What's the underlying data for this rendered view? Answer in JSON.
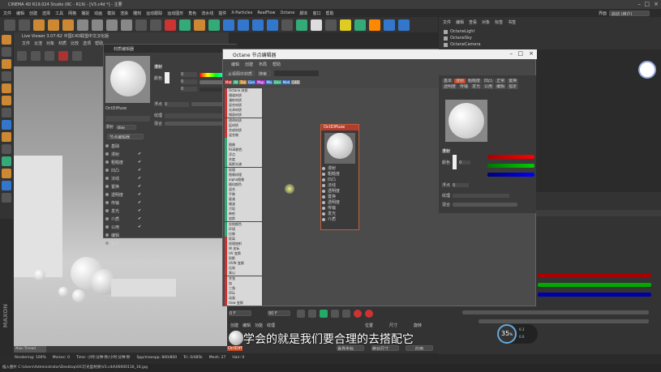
{
  "titlebar": {
    "title": "CINEMA 4D R19.024 Studio (RC - R19) - [V3.c4d *] - 主要"
  },
  "menubar": {
    "items": [
      "文件",
      "编辑",
      "创建",
      "选择",
      "工具",
      "网格",
      "捕捉",
      "动画",
      "模拟",
      "渲染",
      "雕刻",
      "运动跟踪",
      "运动图形",
      "角色",
      "流水线",
      "插件",
      "X-Particles",
      "RealFlow",
      "Octane",
      "脚本",
      "窗口",
      "帮助"
    ],
    "layout_label": "界面",
    "layout_value": "启动 (用户)"
  },
  "live_viewer": {
    "title": "Live Viewer 3.07-R2 中国C4D联盟中文汉化版",
    "menus": [
      "文件",
      "云渲",
      "对象",
      "材质",
      "比较",
      "选项",
      "帮助"
    ]
  },
  "mat_editor": {
    "title": "材质编辑器",
    "mat_name": "OctDiffuse",
    "sections": [
      "基础",
      "漫射",
      "粗糙度",
      "凹凸",
      "法线",
      "置换",
      "透明度",
      "传输",
      "发光",
      "介质",
      "公用",
      "编辑",
      "指定"
    ],
    "diffuse_label": "漫射",
    "color_label": "颜色",
    "float_label": "浮点",
    "texture_label": "纹理",
    "mix_label": "混合",
    "h": "0",
    "s": "0",
    "v": "0",
    "float_val": "0",
    "node_btn": "节点编辑器",
    "mode_label": "漫射"
  },
  "node_editor": {
    "title": "Octane 节点编辑器",
    "menus": [
      "编辑",
      "创建",
      "布局",
      "帮助"
    ],
    "btn_load": "从视图中材质",
    "btn_search": "搜索",
    "tabs": [
      "Mat",
      "All",
      "Tex",
      "Gen",
      "Map",
      "Mis",
      "Emi",
      "Med",
      "C4D"
    ],
    "list": [
      "Octane 材质",
      "通道材质",
      "漫射材质",
      "混合材质",
      "光泽材质",
      "镜面材质",
      "透明材质",
      "层材质",
      "合成材质",
      "混合物",
      ".",
      "图像",
      "RGB颜色",
      "浮点",
      "灰度",
      "高斯光谱",
      "纹理",
      "图像纹理",
      "alpha图像",
      "随机颜色",
      "混合",
      "平移",
      "衰减",
      "噪波",
      "污垢",
      "映射",
      "追踪",
      "实例颜色",
      "环境",
      "位移",
      "距离",
      "纹理放射",
      "W 坐标",
      "UV 变换",
      "投影",
      "UVW 变换",
      "比较",
      "乘以",
      "余弦",
      "加",
      "三角",
      "OSL",
      "动画",
      "Uvw 变换"
    ],
    "node_title": "OctDiffuse",
    "node_ports": [
      "漫射",
      "粗糙度",
      "凹凸",
      "法线",
      "透明度",
      "置换",
      "透明度",
      "传输",
      "发光",
      "介质"
    ]
  },
  "objects": {
    "tabs": [
      "文件",
      "编辑",
      "查看",
      "对象",
      "标签",
      "书签"
    ],
    "items": [
      "OctaneLight",
      "OctaneSky",
      "OctaneCamera"
    ]
  },
  "attributes": {
    "tabs": [
      "基本",
      "漫射",
      "粗糙度",
      "凹凸",
      "正常",
      "置换",
      "透明度",
      "传输",
      "发光",
      "公用",
      "编辑",
      "指定"
    ],
    "section": "漫射",
    "color_label": "颜色",
    "float_label": "浮点",
    "tex_label": "纹理",
    "mix_label": "混合",
    "h": "0",
    "s": "0",
    "v": "0",
    "float_val": "0"
  },
  "timeline": {
    "frame_start": "0 F",
    "frame_end": "90 F",
    "current": "0 F"
  },
  "coords": {
    "tabs": [
      "位置",
      "尺寸",
      "旋转"
    ],
    "apply": "应用",
    "world": "世界坐标",
    "size": "绝对尺寸"
  },
  "mat_manager": {
    "tabs": [
      "创建",
      "编辑",
      "功能",
      "纹理"
    ],
    "mat_name": "OctDiff"
  },
  "status": {
    "render": "Rendering: 100%",
    "ms": "Ms/sec: 0",
    "time": "Time: 小时:分钟:秒/小时:分钟:秒",
    "spp": "Spp/maxspp: 800/800",
    "tri": "Tri: 0/485k",
    "mesh": "Mesh: 27",
    "hair": "Hair: 0",
    "path": "插入图片 C:\\Users\\Administrator\\Desktop\\OC灯光里材质\\V3.c4d\\00000116_16.jpg"
  },
  "subtitle": "学会的就是我们要合理的去搭配它",
  "perf": {
    "pct": "35",
    "unit": "%",
    "net_up": "0.3",
    "net_down": "0.0"
  },
  "colors": {
    "accent": "#c84a2a",
    "node_red": "#b43c2c"
  }
}
